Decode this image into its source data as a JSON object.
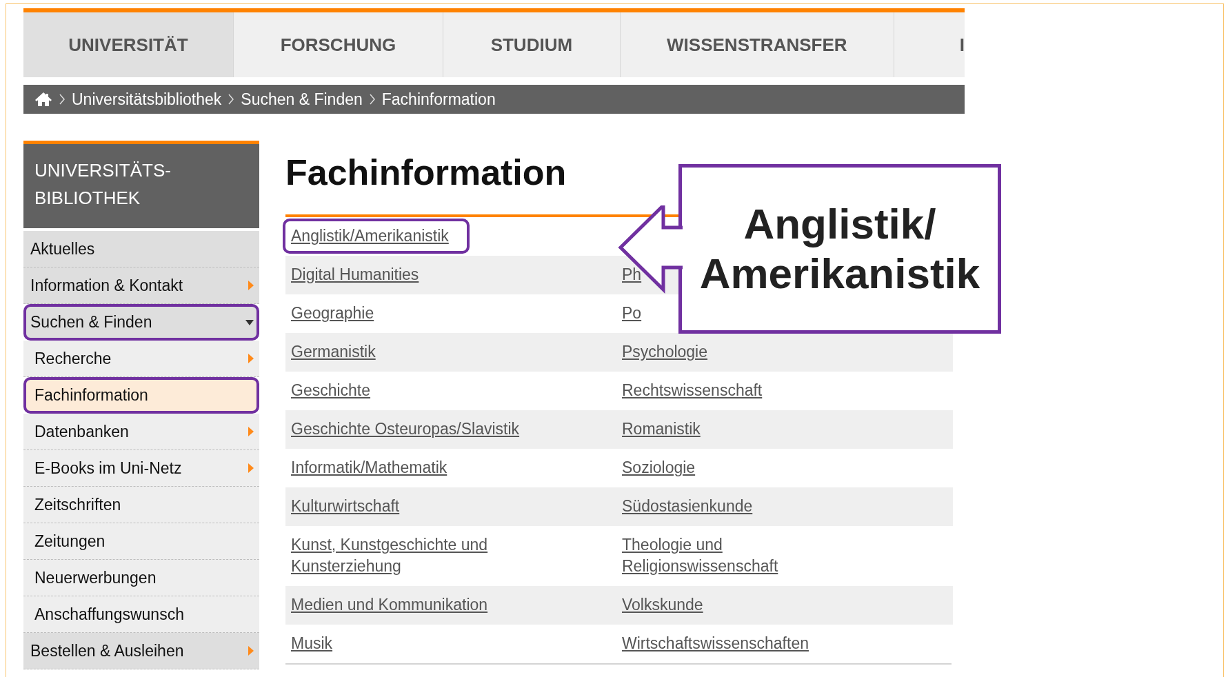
{
  "top_nav": {
    "tabs": [
      {
        "label": "UNIVERSITÄT",
        "selected": true
      },
      {
        "label": "FORSCHUNG",
        "selected": false
      },
      {
        "label": "STUDIUM",
        "selected": false
      },
      {
        "label": "WISSENSTRANSFER",
        "selected": false
      },
      {
        "label": "I",
        "selected": false
      }
    ]
  },
  "breadcrumb": [
    "Universitätsbibliothek",
    "Suchen & Finden",
    "Fachinformation"
  ],
  "sidebar": {
    "title": "UNIVERSITÄTS-BIBLIOTHEK",
    "items": [
      {
        "label": "Aktuelles",
        "submenu": false,
        "selected": false,
        "highlighted": false
      },
      {
        "label": "Information & Kontakt",
        "submenu": true,
        "selected": false,
        "highlighted": false
      },
      {
        "label": "Suchen & Finden",
        "submenu": true,
        "selected": false,
        "highlighted": true,
        "children": [
          {
            "label": "Recherche",
            "submenu": true,
            "selected": false,
            "highlighted": false
          },
          {
            "label": "Fachinformation",
            "submenu": false,
            "selected": true,
            "highlighted": true
          },
          {
            "label": "Datenbanken",
            "submenu": true,
            "selected": false,
            "highlighted": false
          },
          {
            "label": "E-Books im Uni-Netz",
            "submenu": true,
            "selected": false,
            "highlighted": false
          },
          {
            "label": "Zeitschriften",
            "submenu": false,
            "selected": false,
            "highlighted": false
          },
          {
            "label": "Zeitungen",
            "submenu": false,
            "selected": false,
            "highlighted": false
          },
          {
            "label": "Neuerwerbungen",
            "submenu": false,
            "selected": false,
            "highlighted": false
          },
          {
            "label": "Anschaffungswunsch",
            "submenu": false,
            "selected": false,
            "highlighted": false
          }
        ]
      },
      {
        "label": "Bestellen & Ausleihen",
        "submenu": true,
        "selected": false,
        "highlighted": false
      }
    ]
  },
  "main": {
    "heading": "Fachinformation",
    "subjects": [
      [
        {
          "text": "Anglistik/Amerikanistik",
          "highlighted": true
        }
      ],
      [
        {
          "text": "Digital Humanities",
          "highlighted": false
        },
        {
          "text": "Ph",
          "highlighted": false
        }
      ],
      [
        {
          "text": "Geographie",
          "highlighted": false
        },
        {
          "text": "Po",
          "highlighted": false
        }
      ],
      [
        {
          "text": "Germanistik",
          "highlighted": false
        },
        {
          "text": "Psychologie",
          "highlighted": false
        }
      ],
      [
        {
          "text": "Geschichte",
          "highlighted": false
        },
        {
          "text": "Rechtswissenschaft",
          "highlighted": false
        }
      ],
      [
        {
          "text": "Geschichte Osteuropas/Slavistik",
          "highlighted": false
        },
        {
          "text": "Romanistik",
          "highlighted": false
        }
      ],
      [
        {
          "text": "Informatik/Mathematik",
          "highlighted": false
        },
        {
          "text": "Soziologie",
          "highlighted": false
        }
      ],
      [
        {
          "text": "Kulturwirtschaft",
          "highlighted": false
        },
        {
          "text": "Südostasienkunde",
          "highlighted": false
        }
      ],
      [
        {
          "text": "Kunst, Kunstgeschichte und Kunsterziehung",
          "highlighted": false
        },
        {
          "text": "Theologie und Religionswissenschaft",
          "highlighted": false
        }
      ],
      [
        {
          "text": "Medien und Kommunikation",
          "highlighted": false
        },
        {
          "text": "Volkskunde",
          "highlighted": false
        }
      ],
      [
        {
          "text": "Musik",
          "highlighted": false
        },
        {
          "text": "Wirtschaftswissenschaften",
          "highlighted": false
        }
      ]
    ]
  },
  "callout": {
    "lines": [
      "Anglistik/",
      "Amerikanistik"
    ]
  }
}
